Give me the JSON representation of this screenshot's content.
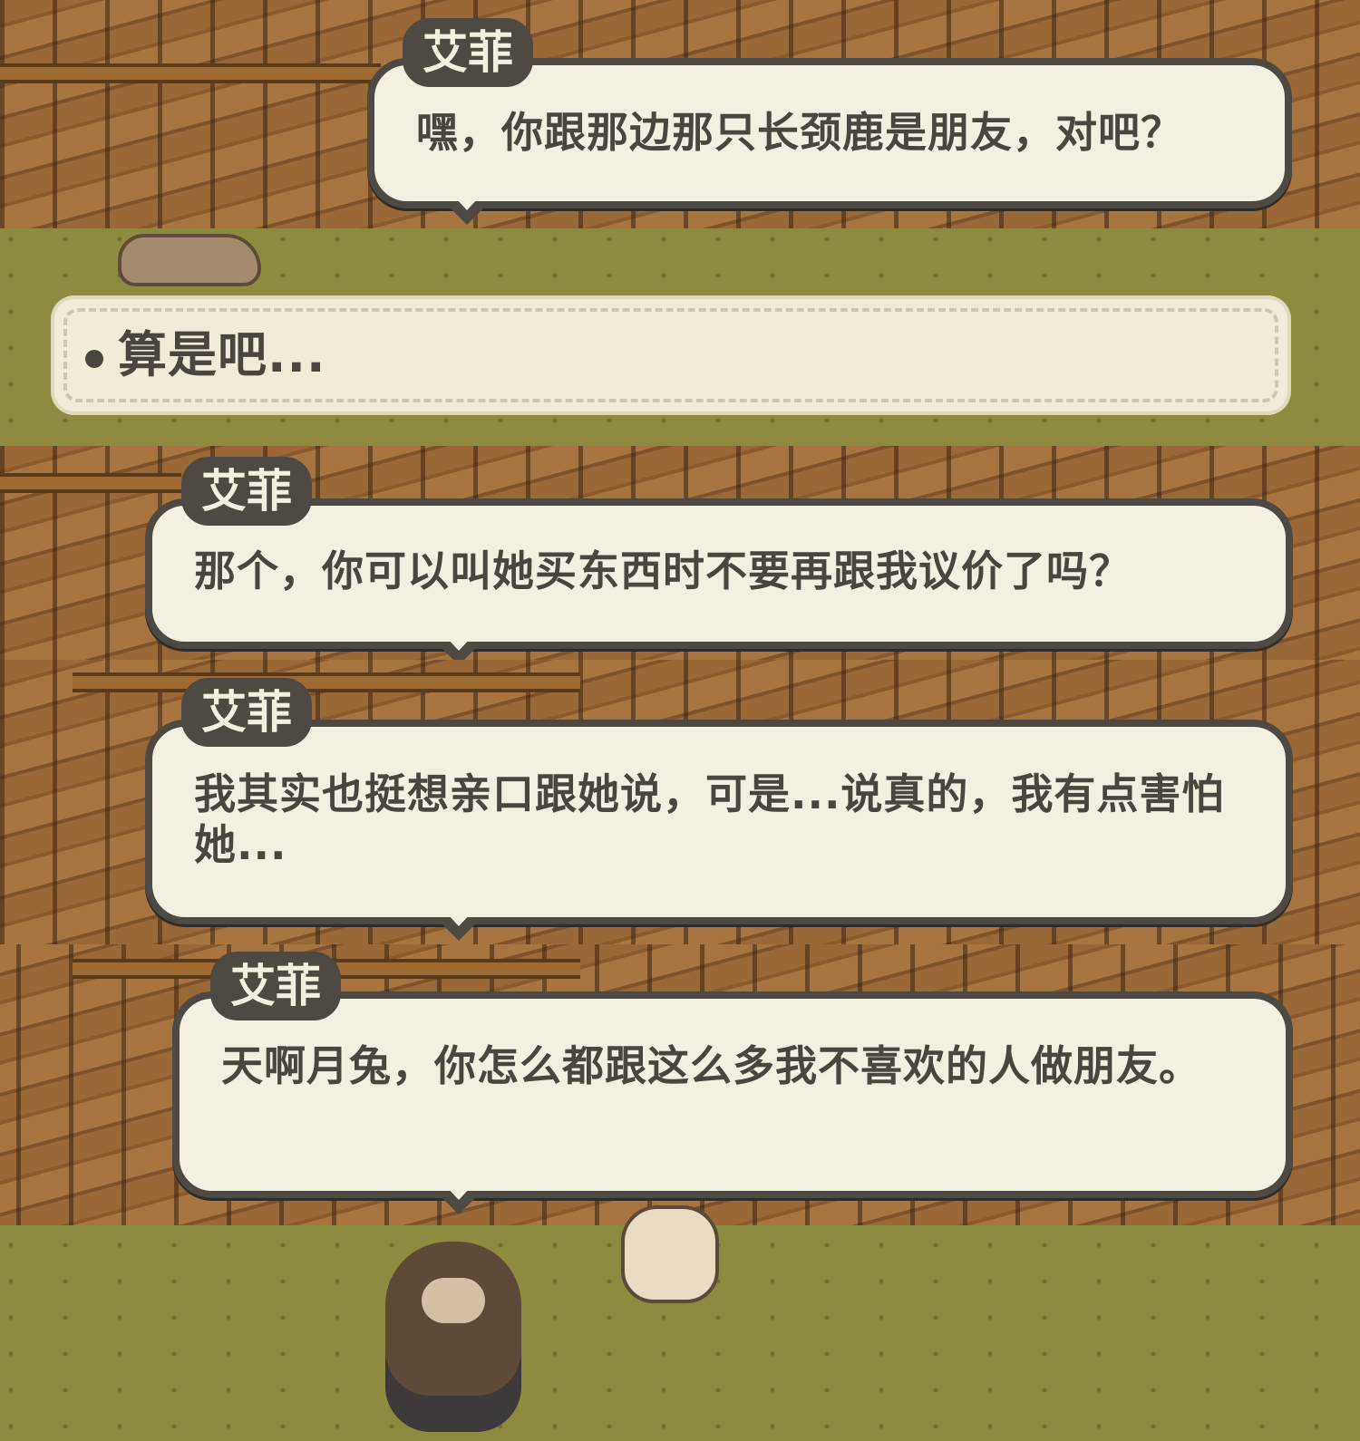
{
  "dialogues": [
    {
      "speaker": "艾菲",
      "line": "嘿，你跟那边那只长颈鹿是朋友，对吧？"
    },
    {
      "speaker": "艾菲",
      "line": "那个，你可以叫她买东西时不要再跟我议价了吗？"
    },
    {
      "speaker": "艾菲",
      "line": "我其实也挺想亲口跟她说，可是...说真的，我有点害怕她..."
    },
    {
      "speaker": "艾菲",
      "line": "天啊月兔，你怎么都跟这么多我不喜欢的人做朋友。"
    }
  ],
  "choice": {
    "option": "算是吧..."
  },
  "icons": [
    "bullet-dot-icon"
  ],
  "colors": {
    "bubble_fill": "#f4f0e1",
    "bubble_border": "#4e4942",
    "text": "#4a453f",
    "grass": "#8d8b3f"
  }
}
